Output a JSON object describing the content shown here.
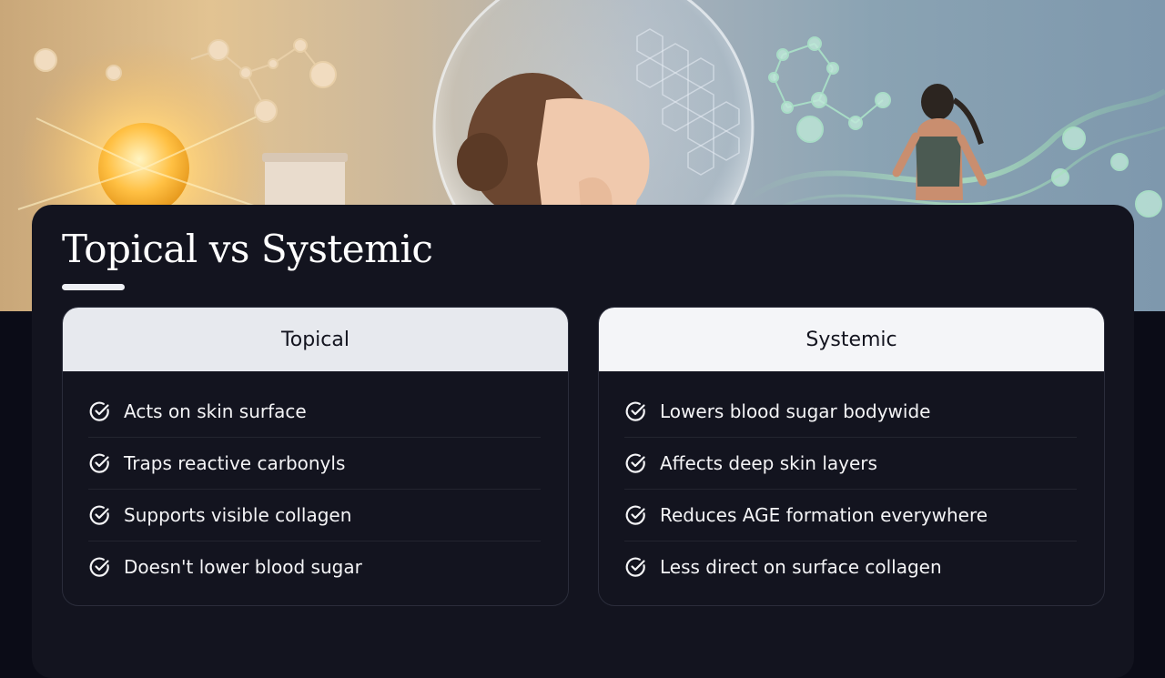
{
  "slide": {
    "title": "Topical vs Systemic",
    "hero_image": "skincare-molecules-banner",
    "colors": {
      "panel_background": "#13141f",
      "page_background": "#0b0c17",
      "header_background": "#e7e9ee",
      "text": "#ffffff"
    }
  },
  "columns": [
    {
      "heading": "Topical",
      "icon": "check-circle-icon",
      "items": [
        "Acts on skin surface",
        "Traps reactive carbonyls",
        "Supports visible collagen",
        "Doesn't lower blood sugar"
      ]
    },
    {
      "heading": "Systemic",
      "icon": "check-circle-icon",
      "items": [
        "Lowers blood sugar bodywide",
        "Affects deep skin layers",
        "Reduces AGE formation everywhere",
        "Less direct on surface collagen"
      ]
    }
  ]
}
